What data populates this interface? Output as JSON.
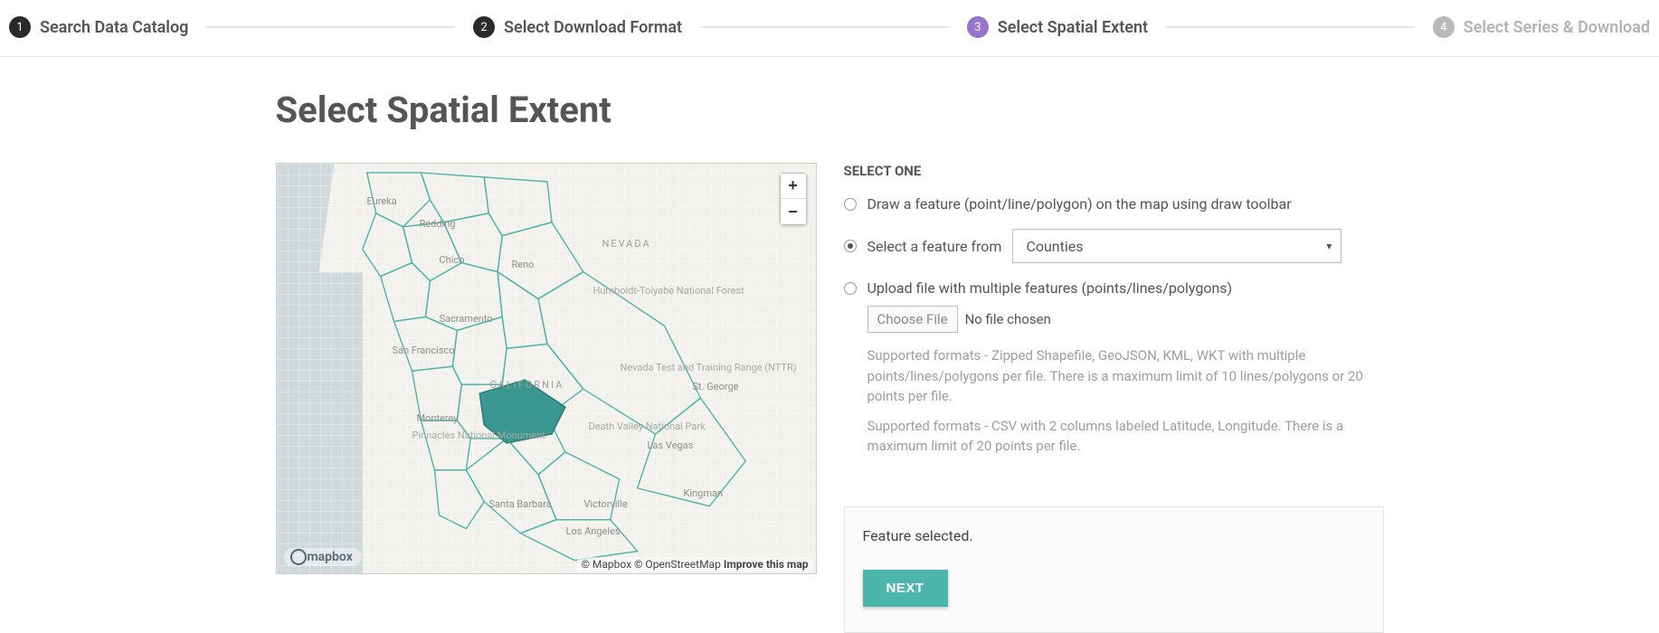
{
  "stepper": {
    "steps": [
      {
        "num": "1",
        "label": "Search Data Catalog",
        "style": "dark",
        "muted": false
      },
      {
        "num": "2",
        "label": "Select Download Format",
        "style": "dark",
        "muted": false
      },
      {
        "num": "3",
        "label": "Select Spatial Extent",
        "style": "purple",
        "muted": false
      },
      {
        "num": "4",
        "label": "Select Series & Download",
        "style": "gray",
        "muted": true
      }
    ]
  },
  "page_title": "Select Spatial Extent",
  "map": {
    "zoom_in": "+",
    "zoom_out": "−",
    "logo": "mapbox",
    "attribution_mapbox": "© Mapbox",
    "attribution_osm": "© OpenStreetMap",
    "improve": "Improve this map",
    "labels": {
      "eureka": "Eureka",
      "redding": "Redding",
      "chico": "Chico",
      "reno": "Reno",
      "sacramento": "Sacramento",
      "sanfrancisco": "San Francisco",
      "california": "CALIFORNIA",
      "nevada": "NEVADA",
      "monterey": "Monterey",
      "santabarbara": "Santa Barbara",
      "losangeles": "Los Angeles",
      "lasvegas": "Las Vegas",
      "kingman": "Kingman",
      "victorville": "Victorville",
      "stgeorge": "St. George",
      "humboldt": "Humboldt-Toiyabe\nNational Forest",
      "nttr": "Nevada Test\nand Training\nRange (NTTR)",
      "deathvalley": "Death Valley\nNational Park",
      "pinnacles": "Pinnacles\nNational Monument"
    }
  },
  "form": {
    "section_label": "SELECT ONE",
    "option_draw": "Draw a feature (point/line/polygon) on the map using draw toolbar",
    "option_select_prefix": "Select a feature from",
    "select_value": "Counties",
    "option_upload": "Upload file with multiple features (points/lines/polygons)",
    "choose_file": "Choose File",
    "no_file": "No file chosen",
    "help1": "Supported formats - Zipped Shapefile, GeoJSON, KML, WKT with multiple points/lines/polygons per file. There is a maximum limit of 10 lines/polygons or 20 points per file.",
    "help2": "Supported formats - CSV with 2 columns labeled Latitude, Longitude. There is a maximum limit of 20 points per file."
  },
  "status": {
    "message": "Feature selected.",
    "next": "NEXT"
  }
}
